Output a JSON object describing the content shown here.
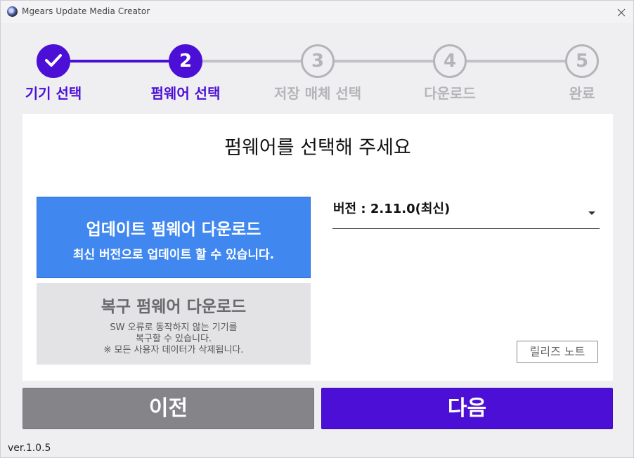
{
  "window": {
    "title": "Mgears Update Media Creator",
    "close_icon": "close-icon"
  },
  "stepper": {
    "steps": [
      {
        "number": "1",
        "label": "기기 선택",
        "state": "done"
      },
      {
        "number": "2",
        "label": "펌웨어 선택",
        "state": "active"
      },
      {
        "number": "3",
        "label": "저장 매체 선택",
        "state": "todo"
      },
      {
        "number": "4",
        "label": "다운로드",
        "state": "todo"
      },
      {
        "number": "5",
        "label": "완료",
        "state": "todo"
      }
    ],
    "accent_color": "#4b0fd6",
    "inactive_color": "#b5b5b9"
  },
  "main": {
    "heading": "펌웨어를 선택해 주세요",
    "options": {
      "update": {
        "title": "업데이트 펌웨어 다운로드",
        "subtitle": "최신 버전으로 업데이트 할 수 있습니다."
      },
      "recovery": {
        "title": "복구 펌웨어 다운로드",
        "line1": "SW 오류로 동작하지 않는 기기를",
        "line2": "복구할 수 있습니다.",
        "line3": "※ 모든 사용자 데이터가 삭제됩니다."
      }
    },
    "version_select": {
      "value": "버전 : 2.11.0(최신)"
    },
    "release_notes_label": "릴리즈 노트"
  },
  "footer": {
    "prev_label": "이전",
    "next_label": "다음",
    "version": "ver.1.0.5"
  },
  "colors": {
    "primary": "#4b0fd6",
    "option_selected": "#4088f0",
    "option_unselected": "#e3e3e6",
    "prev_button": "#858589"
  }
}
